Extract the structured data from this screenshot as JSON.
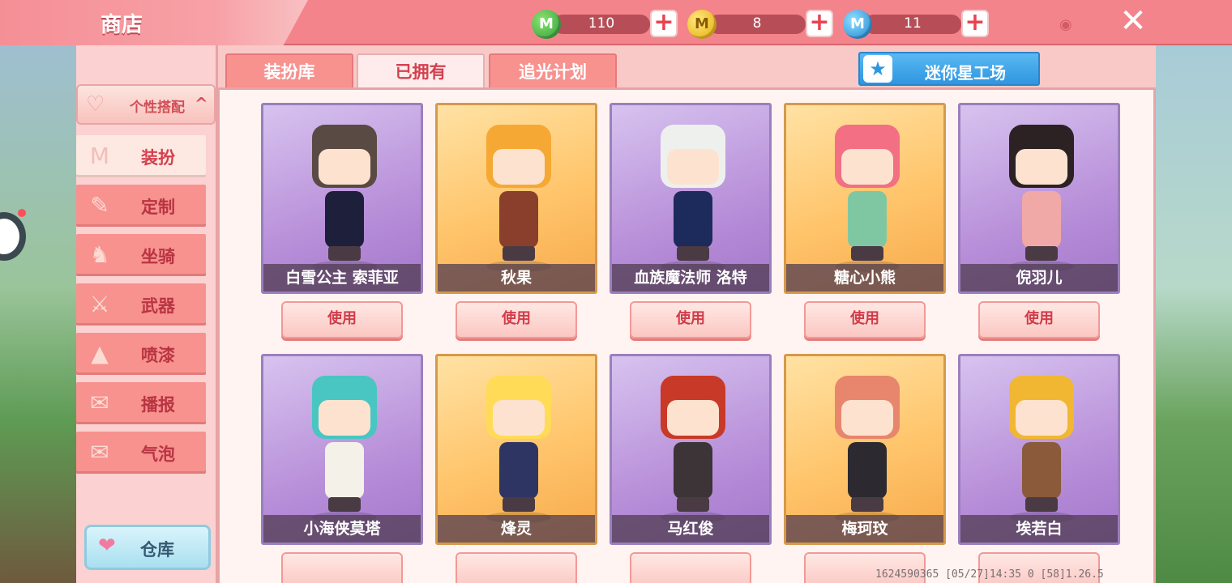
{
  "header": {
    "title": "商店",
    "currencies": [
      {
        "icon": "green-coin-icon",
        "value": "110",
        "add": "+"
      },
      {
        "icon": "gold-coin-icon",
        "value": "8",
        "add": "+"
      },
      {
        "icon": "blue-coin-icon",
        "value": "11",
        "add": "+"
      }
    ],
    "coin_letter": "M",
    "close": "✕",
    "signal": "◉"
  },
  "sidebar": {
    "header": "个性搭配",
    "header_icon": "♡",
    "chevron": "^",
    "items": [
      {
        "label": "装扮",
        "icon": "shirt-icon",
        "glyph": "M"
      },
      {
        "label": "定制",
        "icon": "brush-icon",
        "glyph": "✎"
      },
      {
        "label": "坐骑",
        "icon": "mount-icon",
        "glyph": "♞"
      },
      {
        "label": "武器",
        "icon": "gun-icon",
        "glyph": "⚔"
      },
      {
        "label": "喷漆",
        "icon": "spray-icon",
        "glyph": "▲"
      },
      {
        "label": "播报",
        "icon": "broadcast-icon",
        "glyph": "✉"
      },
      {
        "label": "气泡",
        "icon": "bubble-icon",
        "glyph": "✉"
      }
    ],
    "active_index": 0,
    "warehouse": {
      "label": "仓库",
      "glyph": "❤"
    }
  },
  "tabs": [
    {
      "label": "装扮库"
    },
    {
      "label": "已拥有"
    },
    {
      "label": "追光计划"
    }
  ],
  "active_tab": 1,
  "mini_star": {
    "label": "迷你星工场",
    "glyph": "★"
  },
  "cards_row1": [
    {
      "name": "白雪公主 索菲亚",
      "bg": "purple",
      "hair": "#5a4a44",
      "outfit": "#1e1f3a",
      "use": "使用"
    },
    {
      "name": "秋果",
      "bg": "orange",
      "hair": "#f5a934",
      "outfit": "#8a3f2c",
      "use": "使用"
    },
    {
      "name": "血族魔法师 洛特",
      "bg": "purple",
      "hair": "#eef0ee",
      "outfit": "#1c2a5c",
      "use": "使用"
    },
    {
      "name": "糖心小熊",
      "bg": "orange",
      "hair": "#f36f84",
      "outfit": "#7fc7a2",
      "use": "使用"
    },
    {
      "name": "倪羽儿",
      "bg": "purple",
      "hair": "#2c2224",
      "outfit": "#f1a9a7",
      "use": "使用"
    }
  ],
  "cards_row2": [
    {
      "name": "小海侠莫塔",
      "bg": "purple",
      "hair": "#49c6c2",
      "outfit": "#f4f1e8"
    },
    {
      "name": "烽灵",
      "bg": "orange",
      "hair": "#ffdb57",
      "outfit": "#2f3562"
    },
    {
      "name": "马红俊",
      "bg": "purple",
      "hair": "#c83a27",
      "outfit": "#3c3436"
    },
    {
      "name": "梅珂玟",
      "bg": "orange",
      "hair": "#e7866c",
      "outfit": "#2c2a30"
    },
    {
      "name": "埃若白",
      "bg": "purple",
      "hair": "#f1b733",
      "outfit": "#8a5a3a"
    }
  ],
  "footer": "1624590365   [05/27]14:35 0   [58]1.26.5"
}
